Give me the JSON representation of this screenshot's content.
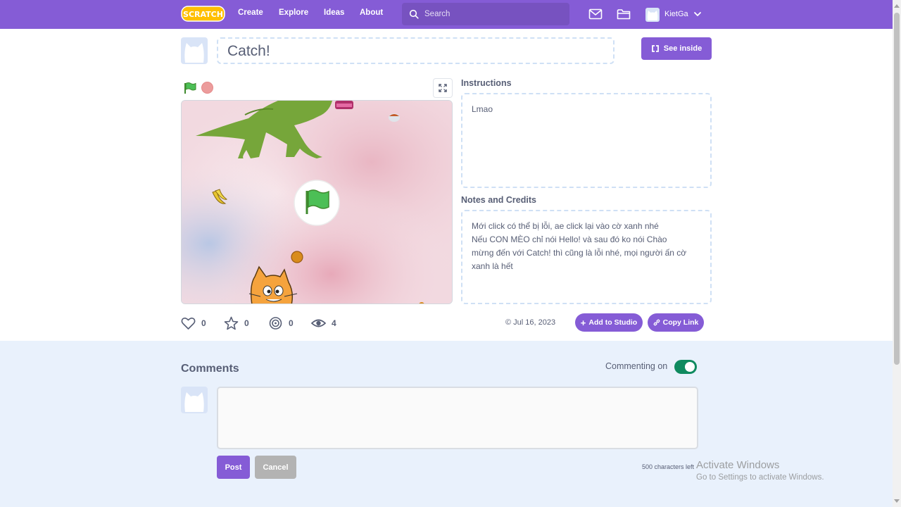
{
  "navbar": {
    "logo_text": "SCRATCH",
    "links": [
      "Create",
      "Explore",
      "Ideas",
      "About"
    ],
    "search_placeholder": "Search",
    "username": "KietGa"
  },
  "project": {
    "title": "Catch!",
    "see_inside_label": "See inside",
    "instructions_label": "Instructions",
    "instructions_text": "Lmao",
    "notes_label": "Notes and Credits",
    "notes_lines": [
      "Mới click có thể bị lỗi, ae click lại vào cờ xanh nhé",
      "Nếu CON MÈO chỉ nói Hello! và sau đó ko nói Chào",
      "mừng đến với Catch! thì cũng là lỗi nhé, mọi người ấn cờ",
      "xanh là hết"
    ]
  },
  "stats": {
    "loves": "0",
    "favorites": "0",
    "remixes": "0",
    "views": "4",
    "date": "Jul 16, 2023",
    "add_to_studio_label": "Add to Studio",
    "copy_link_label": "Copy Link"
  },
  "comments": {
    "title": "Comments",
    "commenting_label": "Commenting on",
    "commenting_enabled": true,
    "post_label": "Post",
    "cancel_label": "Cancel",
    "chars_left": "500 characters left"
  },
  "watermark": {
    "title": "Activate Windows",
    "subtitle": "Go to Settings to activate Windows."
  },
  "colors": {
    "brand_purple": "#855cd6",
    "comments_bg": "#e9f1fc",
    "toggle_on": "#0f8a5f"
  }
}
